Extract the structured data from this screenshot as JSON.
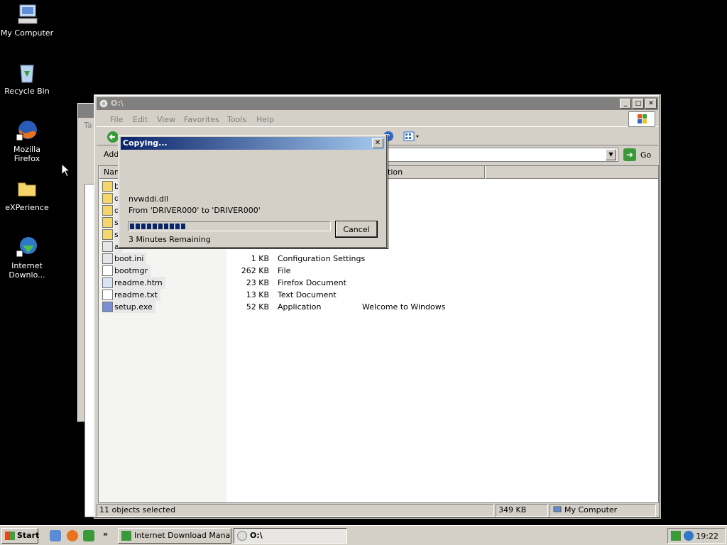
{
  "desktop": {
    "icons": [
      {
        "label": "My Computer",
        "icon": "my-computer-icon"
      },
      {
        "label": "Recycle Bin",
        "icon": "recycle-bin-icon"
      },
      {
        "label": "Mozilla Firefox",
        "icon": "firefox-icon"
      },
      {
        "label": "eXPerience",
        "icon": "folder-icon"
      },
      {
        "label": "Internet Downlo...",
        "icon": "idm-icon"
      }
    ]
  },
  "bg_window": {
    "partial_text": "Ta"
  },
  "explorer": {
    "title": "O:\\",
    "menu": [
      "File",
      "Edit",
      "View",
      "Favorites",
      "Tools",
      "Help"
    ],
    "address_label": "Add",
    "go_label": "Go",
    "columns": [
      "Name",
      "tion"
    ],
    "files": [
      {
        "name": "b",
        "size": "",
        "type": "",
        "comment": "",
        "icon": "folder-icon"
      },
      {
        "name": "d",
        "size": "",
        "type": "",
        "comment": "",
        "icon": "folder-icon"
      },
      {
        "name": "d",
        "size": "",
        "type": "",
        "comment": "",
        "icon": "folder-icon"
      },
      {
        "name": "s",
        "size": "",
        "type": "",
        "comment": "",
        "icon": "folder-icon"
      },
      {
        "name": "s",
        "size": "",
        "type": "",
        "comment": "",
        "icon": "folder-icon"
      },
      {
        "name": "a",
        "size": "",
        "type": "",
        "comment": "",
        "icon": "settings-file-icon"
      },
      {
        "name": "boot.ini",
        "size": "1 KB",
        "type": "Configuration Settings",
        "comment": "",
        "icon": "settings-file-icon"
      },
      {
        "name": "bootmgr",
        "size": "262 KB",
        "type": "File",
        "comment": "",
        "icon": "file-icon"
      },
      {
        "name": "readme.htm",
        "size": "23 KB",
        "type": "Firefox Document",
        "comment": "",
        "icon": "html-file-icon"
      },
      {
        "name": "readme.txt",
        "size": "13 KB",
        "type": "Text Document",
        "comment": "",
        "icon": "text-file-icon"
      },
      {
        "name": "setup.exe",
        "size": "52 KB",
        "type": "Application",
        "comment": "Welcome to Windows",
        "icon": "exe-icon"
      }
    ],
    "status": {
      "selected": "11 objects selected",
      "size": "349 KB",
      "location": "My Computer"
    }
  },
  "copy_dialog": {
    "title": "Copying...",
    "filename": "nvwddi.dll",
    "from_to": "From 'DRIVER000' to 'DRIVER000'",
    "remaining": "3 Minutes Remaining",
    "progress": 0.28,
    "cancel_label": "Cancel"
  },
  "taskbar": {
    "start_label": "Start",
    "overflow": "»",
    "tasks": [
      {
        "label": "Internet Download Mana...",
        "active": false
      },
      {
        "label": "O:\\",
        "active": true
      }
    ],
    "clock": "19:22"
  }
}
